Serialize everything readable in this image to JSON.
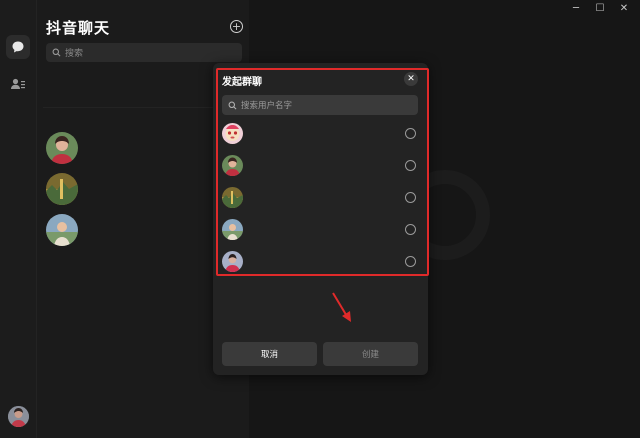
{
  "app": {
    "title": "抖音聊天",
    "add_icon": "plus-circle-icon"
  },
  "sidebar": {
    "search_placeholder": "搜索",
    "icons": [
      "chat-bubble-icon",
      "contacts-icon"
    ]
  },
  "conversations": [
    {
      "avatar": "avatar-girl-red"
    },
    {
      "avatar": "avatar-field-landscape"
    },
    {
      "avatar": "avatar-child-outdoor"
    }
  ],
  "window_controls": [
    "minimize-icon",
    "maximize-icon",
    "close-icon"
  ],
  "modal": {
    "title": "发起群聊",
    "search_placeholder": "搜索用户名字",
    "users": [
      {
        "avatar": "avatar-cartoon-character",
        "selected": false
      },
      {
        "avatar": "avatar-girl-red",
        "selected": false
      },
      {
        "avatar": "avatar-field-landscape",
        "selected": false
      },
      {
        "avatar": "avatar-child-outdoor",
        "selected": false
      },
      {
        "avatar": "avatar-person-sky",
        "selected": false
      }
    ],
    "cancel_label": "取消",
    "create_label": "创建"
  },
  "colors": {
    "background": "#161616",
    "panel": "#1b1b1b",
    "modal": "#232323",
    "highlight_box": "#e02a2a"
  }
}
